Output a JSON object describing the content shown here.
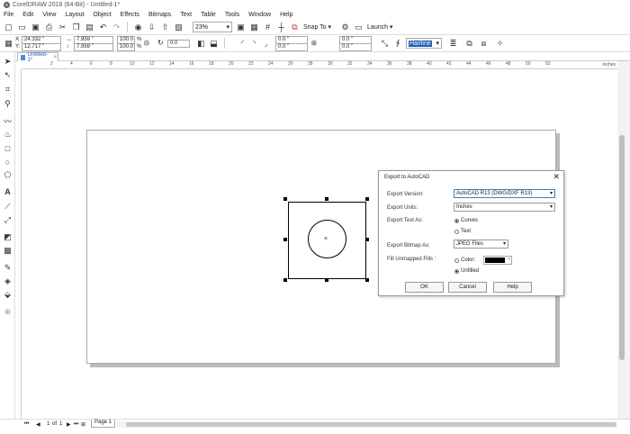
{
  "window": {
    "title": "CorelDRAW 2018 (64-Bit) - Untitled-1*"
  },
  "menu": [
    "File",
    "Edit",
    "View",
    "Layout",
    "Object",
    "Effects",
    "Bitmaps",
    "Text",
    "Table",
    "Tools",
    "Window",
    "Help"
  ],
  "toolbar": {
    "zoom": "23%",
    "snap_to": "Snap To",
    "launch": "Launch"
  },
  "propbar": {
    "x": "24.332 \"",
    "y": "12.717 \"",
    "w": "7.959 \"",
    "h": "7.959 \"",
    "scale_w": "100.0",
    "scale_h": "100.0",
    "percent": "%",
    "rotation": "0.0",
    "p1": "0.0 \"",
    "p2": "0.0 \"",
    "p3": "0.0 \"",
    "p4": "0.0 \"",
    "outline": "Hairline"
  },
  "document_tab": "Untitled-1*",
  "ruler": {
    "ticks": [
      "2",
      "4",
      "6",
      "8",
      "10",
      "12",
      "14",
      "16",
      "18",
      "20",
      "22",
      "24",
      "26",
      "28",
      "30",
      "32",
      "34",
      "36",
      "38",
      "40",
      "42",
      "44",
      "46",
      "48",
      "50",
      "52"
    ],
    "unit": "inches"
  },
  "page_nav": {
    "current": "1",
    "of_label": "of",
    "total": "1",
    "page_tab": "Page 1"
  },
  "dialog": {
    "title": "Export to AutoCAD",
    "export_version_label": "Export Version:",
    "export_version": "AutoCAD R13 (DWG/DXF R13)",
    "export_units_label": "Export Units:",
    "export_units": "Inches",
    "export_text_label": "Export Text As:",
    "text_opt_curves": "Curves",
    "text_opt_text": "Text",
    "bitmap_label": "Export Bitmap As:",
    "bitmap_value": "JPEG Files",
    "fill_label": "Fill Unmapped Fills :",
    "fill_color": "Color:",
    "fill_unfilled": "Unfilled",
    "ok": "OK",
    "cancel": "Cancel",
    "help": "Help"
  }
}
